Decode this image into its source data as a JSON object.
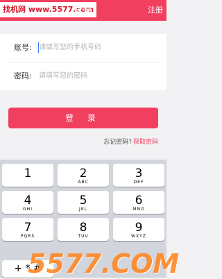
{
  "header": {
    "watermark": "找机网 www.5577.com",
    "title": "登录",
    "register_label": "注册"
  },
  "form": {
    "account_label": "账号:",
    "account_placeholder": "请填写您的手机号码",
    "password_label": "密码:",
    "password_placeholder": "请填写您的密码"
  },
  "login_button": "登 录",
  "links": {
    "forgot": "忘记密码?",
    "recover": "获取密码"
  },
  "keypad": {
    "keys": [
      {
        "digit": "1",
        "letters": ""
      },
      {
        "digit": "2",
        "letters": "ABC"
      },
      {
        "digit": "3",
        "letters": "DEF"
      },
      {
        "digit": "4",
        "letters": "GHI"
      },
      {
        "digit": "5",
        "letters": "JKL"
      },
      {
        "digit": "6",
        "letters": "MNO"
      },
      {
        "digit": "7",
        "letters": "PQRS"
      },
      {
        "digit": "8",
        "letters": "TUV"
      },
      {
        "digit": "9",
        "letters": "WXYZ"
      }
    ],
    "alt_key": "+ * #"
  },
  "watermark_bottom": "5577.COM",
  "colors": {
    "accent": "#f13f60",
    "background": "#f2f2f4",
    "keypad_bg": "#d2d5db"
  }
}
